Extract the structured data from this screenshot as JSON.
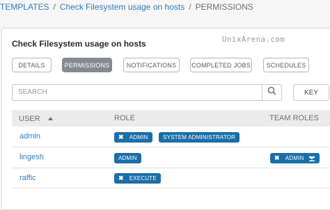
{
  "breadcrumb": {
    "root": "TEMPLATES",
    "item": "Check Filesystem usage on hosts",
    "current": "PERMISSIONS",
    "separator": "/"
  },
  "watermark": "UnixArena.com",
  "card_title": "Check Filesystem usage on hosts",
  "tabs": [
    {
      "label": "DETAILS",
      "active": false
    },
    {
      "label": "PERMISSIONS",
      "active": true
    },
    {
      "label": "NOTIFICATIONS",
      "active": false
    },
    {
      "label": "COMPLETED JOBS",
      "active": false
    },
    {
      "label": "SCHEDULES",
      "active": false
    }
  ],
  "search": {
    "placeholder": "SEARCH"
  },
  "key_button": "KEY",
  "table": {
    "headers": {
      "user": "USER",
      "role": "ROLE",
      "team_roles": "TEAM ROLES"
    },
    "rows": [
      {
        "user": "admin",
        "roles": [
          "ADMIN",
          "SYSTEM ADMINISTRATOR"
        ],
        "team_roles": []
      },
      {
        "user": "lingesh",
        "roles": [
          "ADMIN"
        ],
        "team_roles": [
          "ADMIN"
        ]
      },
      {
        "user": "raffic",
        "roles": [
          "EXECUTE"
        ],
        "team_roles": []
      }
    ]
  },
  "colors": {
    "link": "#337ab7",
    "badge": "#1a6ea8",
    "active_tab": "#848992"
  }
}
